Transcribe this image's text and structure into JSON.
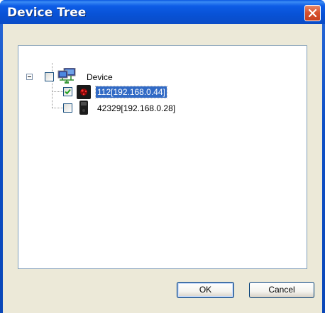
{
  "window": {
    "title": "Device Tree"
  },
  "tree": {
    "root": {
      "label": "Device",
      "expanded": true,
      "checked": false,
      "icon": "network-computers-icon"
    },
    "children": [
      {
        "label": "112[192.168.0.44]",
        "checked": true,
        "selected": true,
        "icon": "device-reader-red-icon"
      },
      {
        "label": "42329[192.168.0.28]",
        "checked": false,
        "selected": false,
        "icon": "device-terminal-icon"
      }
    ]
  },
  "buttons": {
    "ok": "OK",
    "cancel": "Cancel"
  },
  "colors": {
    "titlebar": "#0a58e2",
    "selection": "#316ac5",
    "close": "#d8532f",
    "dialog_face": "#ece9d8"
  }
}
